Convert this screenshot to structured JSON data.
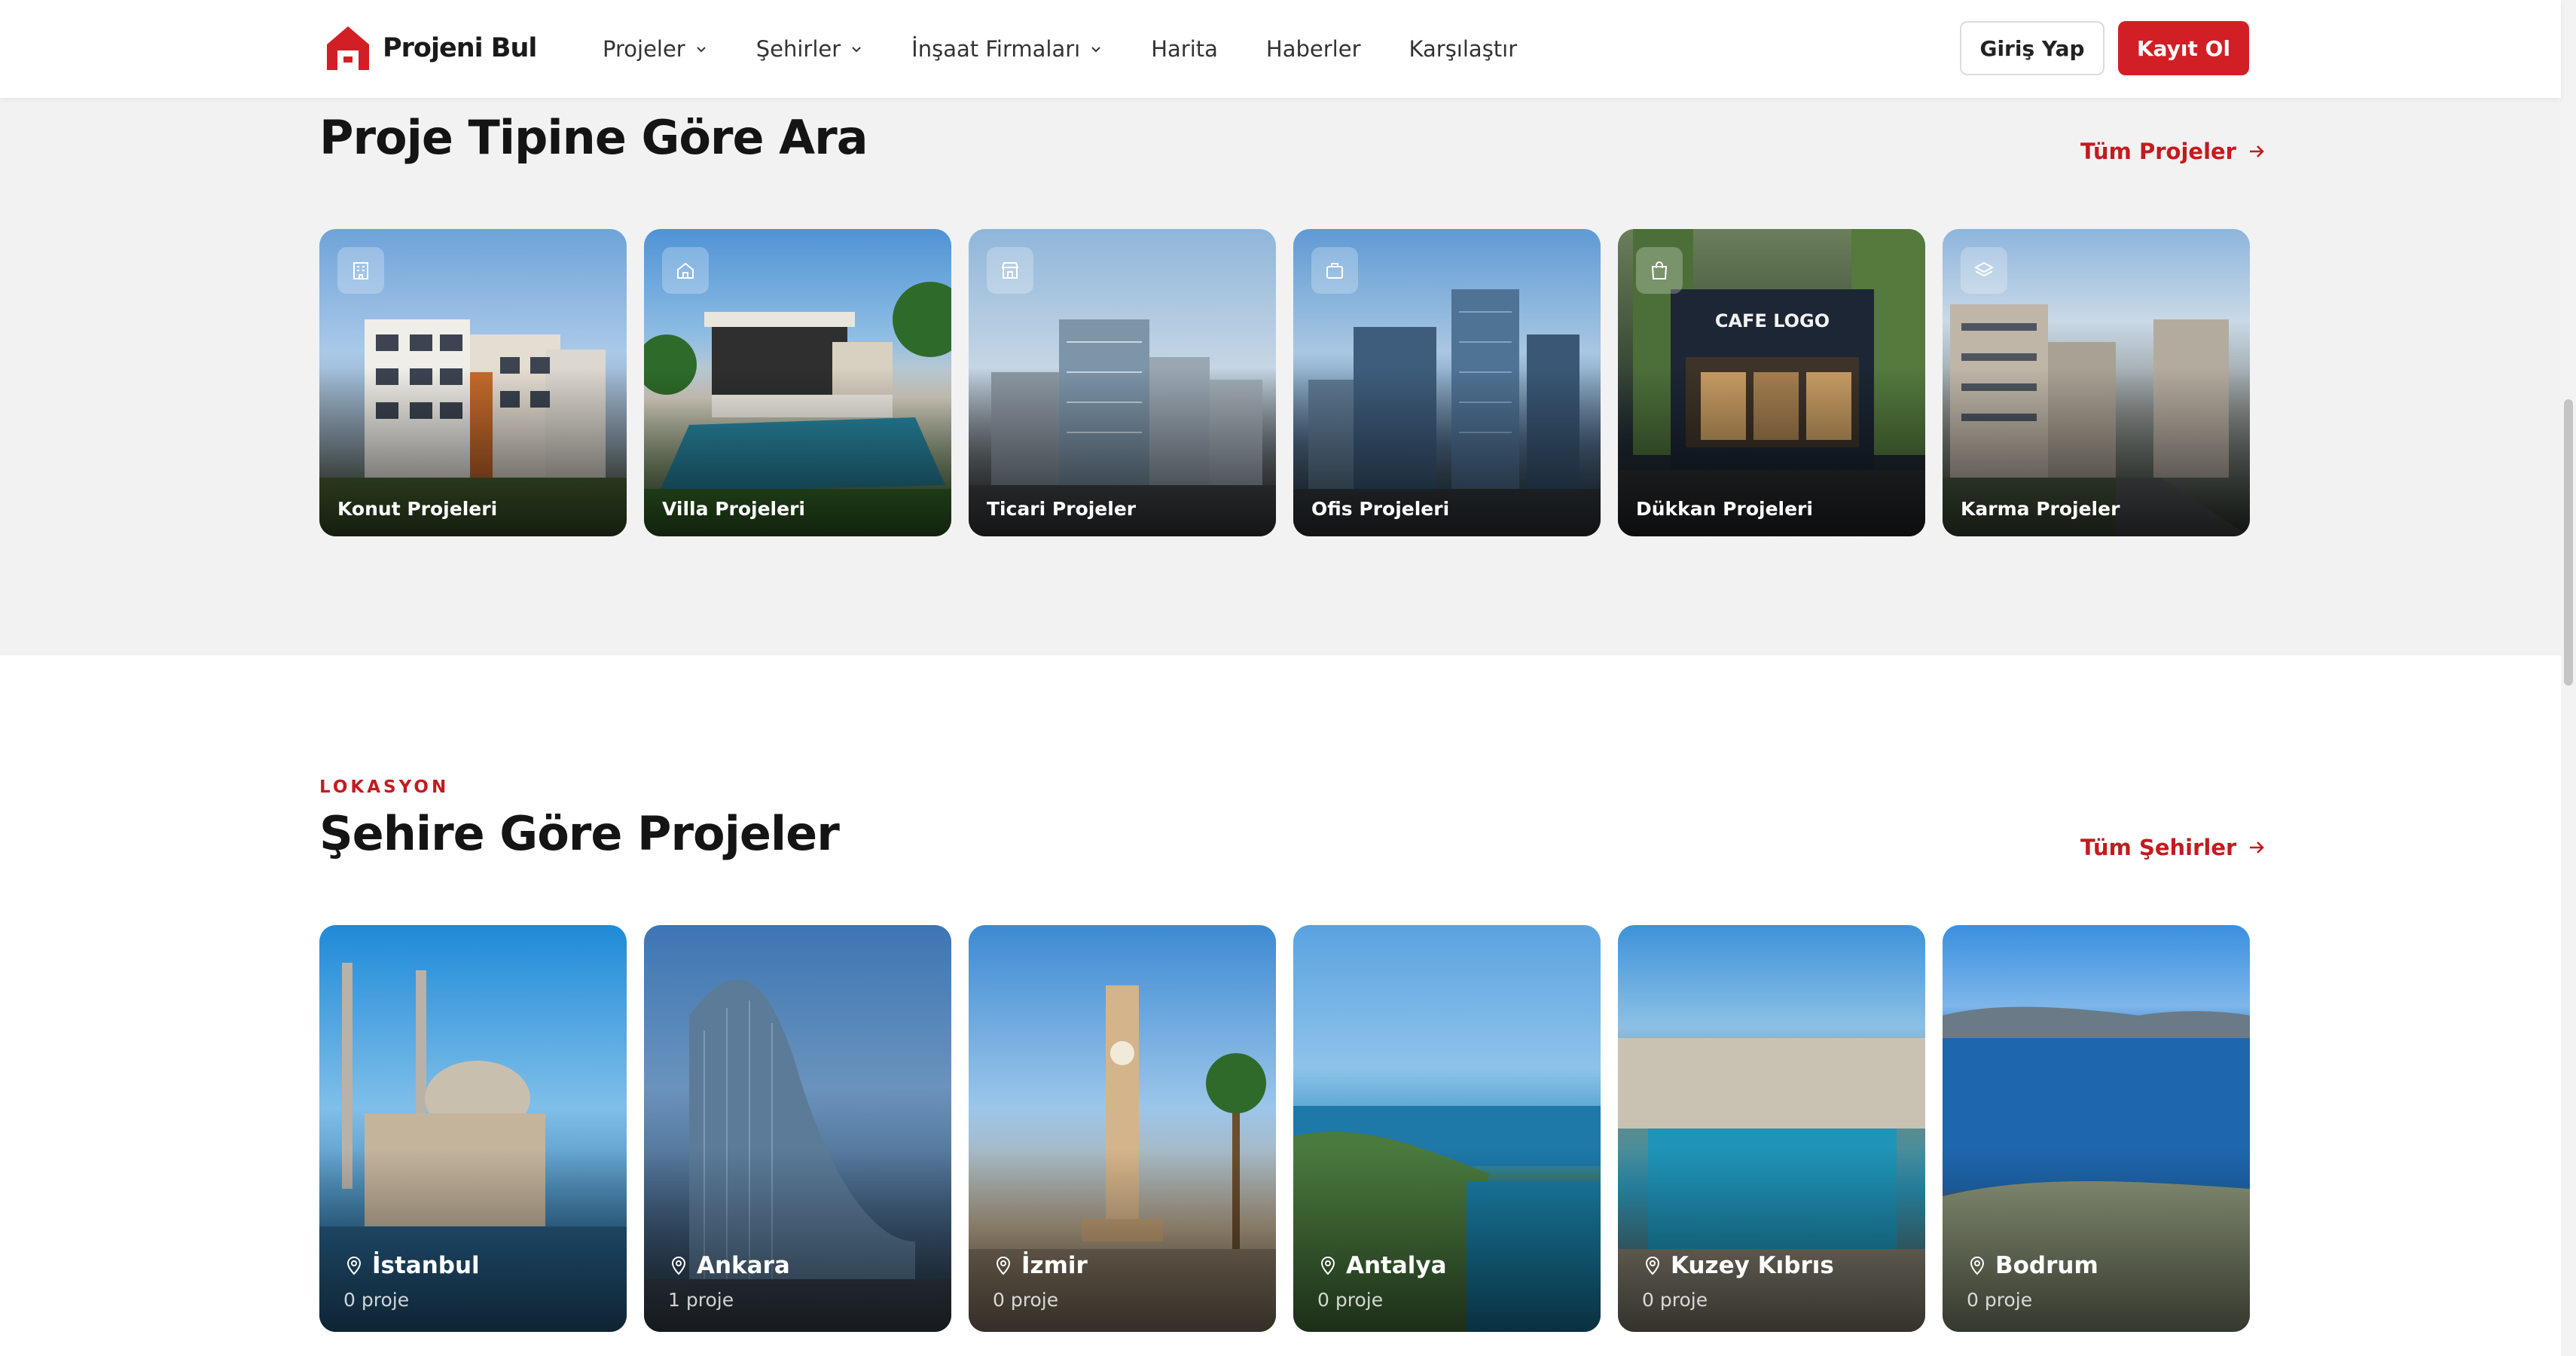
{
  "header": {
    "brand": "Projeni Bul",
    "nav": [
      {
        "label": "Projeler",
        "dropdown": true
      },
      {
        "label": "Şehirler",
        "dropdown": true
      },
      {
        "label": "İnşaat Firmaları",
        "dropdown": true
      },
      {
        "label": "Harita",
        "dropdown": false
      },
      {
        "label": "Haberler",
        "dropdown": false
      },
      {
        "label": "Karşılaştır",
        "dropdown": false
      }
    ],
    "login_label": "Giriş Yap",
    "register_label": "Kayıt Ol"
  },
  "project_types": {
    "title": "Proje Tipine Göre Ara",
    "all_link": "Tüm Projeler",
    "cards": [
      {
        "label": "Konut Projeleri",
        "icon": "building-icon"
      },
      {
        "label": "Villa Projeleri",
        "icon": "house-icon"
      },
      {
        "label": "Ticari Projeler",
        "icon": "store-icon"
      },
      {
        "label": "Ofis Projeleri",
        "icon": "briefcase-icon"
      },
      {
        "label": "Dükkan Projeleri",
        "icon": "shopping-bag-icon"
      },
      {
        "label": "Karma Projeler",
        "icon": "layers-icon"
      }
    ]
  },
  "cities": {
    "kicker": "LOKASYON",
    "title": "Şehire Göre Projeler",
    "all_link": "Tüm Şehirler",
    "items": [
      {
        "name": "İstanbul",
        "count": "0 proje"
      },
      {
        "name": "Ankara",
        "count": "1 proje"
      },
      {
        "name": "İzmir",
        "count": "0 proje"
      },
      {
        "name": "Antalya",
        "count": "0 proje"
      },
      {
        "name": "Kuzey Kıbrıs",
        "count": "0 proje"
      },
      {
        "name": "Bodrum",
        "count": "0 proje"
      }
    ]
  },
  "colors": {
    "accent": "#d21f26",
    "section_bg": "#f2f2f2"
  }
}
